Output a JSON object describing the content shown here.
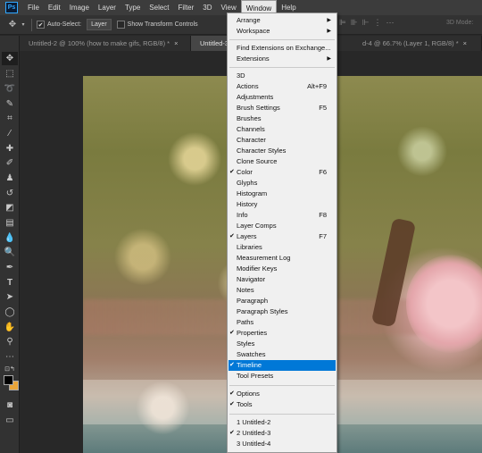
{
  "app": {
    "logo": "Ps"
  },
  "menubar": {
    "items": [
      "File",
      "Edit",
      "Image",
      "Layer",
      "Type",
      "Select",
      "Filter",
      "3D",
      "View",
      "Window",
      "Help"
    ],
    "active": "Window"
  },
  "options_bar": {
    "auto_select_label": "Auto-Select:",
    "auto_select_checked": true,
    "auto_select_value": "Layer",
    "show_transform_label": "Show Transform Controls",
    "show_transform_checked": false,
    "mode_3d_label": "3D Mode:"
  },
  "tabs": [
    {
      "label": "Untitled-2 @ 100% (how to make gifs, RGB/8) *",
      "active": false
    },
    {
      "label": "Untitled-3 @",
      "active": true
    },
    {
      "label": "d-4 @ 66.7% (Layer 1, RGB/8) *",
      "active": false
    }
  ],
  "tools": [
    "move-icon",
    "marquee-icon",
    "lasso-icon",
    "quick-select-icon",
    "crop-icon",
    "eyedropper-icon",
    "healing-icon",
    "brush-icon",
    "clone-stamp-icon",
    "history-brush-icon",
    "eraser-icon",
    "gradient-icon",
    "blur-icon",
    "dodge-icon",
    "pen-icon",
    "type-icon",
    "path-select-icon",
    "ellipse-icon",
    "hand-icon",
    "zoom-icon"
  ],
  "colors": {
    "foreground": "#000000",
    "background": "#e8a43a",
    "menu_highlight": "#0078d7"
  },
  "window_menu": {
    "items": [
      {
        "label": "Arrange",
        "submenu": true
      },
      {
        "label": "Workspace",
        "submenu": true
      },
      {
        "label": "Find Extensions on Exchange..."
      },
      {
        "label": "Extensions",
        "submenu": true
      },
      {
        "label": "3D"
      },
      {
        "label": "Actions",
        "shortcut": "Alt+F9"
      },
      {
        "label": "Adjustments"
      },
      {
        "label": "Brush Settings",
        "shortcut": "F5"
      },
      {
        "label": "Brushes"
      },
      {
        "label": "Channels"
      },
      {
        "label": "Character"
      },
      {
        "label": "Character Styles"
      },
      {
        "label": "Clone Source"
      },
      {
        "label": "Color",
        "shortcut": "F6",
        "checked": true
      },
      {
        "label": "Glyphs"
      },
      {
        "label": "Histogram"
      },
      {
        "label": "History"
      },
      {
        "label": "Info",
        "shortcut": "F8"
      },
      {
        "label": "Layer Comps"
      },
      {
        "label": "Layers",
        "shortcut": "F7",
        "checked": true
      },
      {
        "label": "Libraries"
      },
      {
        "label": "Measurement Log"
      },
      {
        "label": "Modifier Keys"
      },
      {
        "label": "Navigator"
      },
      {
        "label": "Notes"
      },
      {
        "label": "Paragraph"
      },
      {
        "label": "Paragraph Styles"
      },
      {
        "label": "Paths"
      },
      {
        "label": "Properties",
        "checked": true
      },
      {
        "label": "Styles"
      },
      {
        "label": "Swatches"
      },
      {
        "label": "Timeline",
        "checked": true,
        "highlighted": true
      },
      {
        "label": "Tool Presets"
      },
      {
        "label": "Options",
        "checked": true
      },
      {
        "label": "Tools",
        "checked": true
      },
      {
        "label": "1 Untitled-2"
      },
      {
        "label": "2 Untitled-3",
        "checked": true
      },
      {
        "label": "3 Untitled-4"
      }
    ]
  }
}
